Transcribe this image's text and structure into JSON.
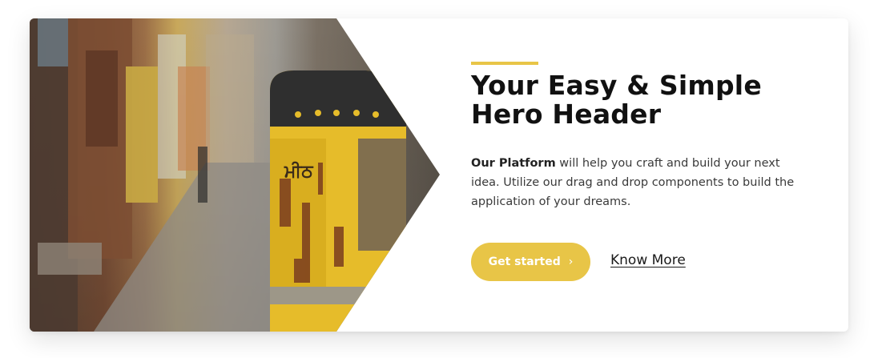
{
  "hero": {
    "accent_color": "#e8c547",
    "title": "Your Easy & Simple Hero Header",
    "description": {
      "strong": "Our Platform",
      "rest": " will help you craft and build your next idea. Utilize our drag and drop components to build the application of your dreams."
    },
    "primary_button": {
      "label": "Get started",
      "icon": "chevron-right-icon"
    },
    "secondary_link": {
      "label": "Know More"
    },
    "image": {
      "subject": "street-scene-image"
    }
  }
}
